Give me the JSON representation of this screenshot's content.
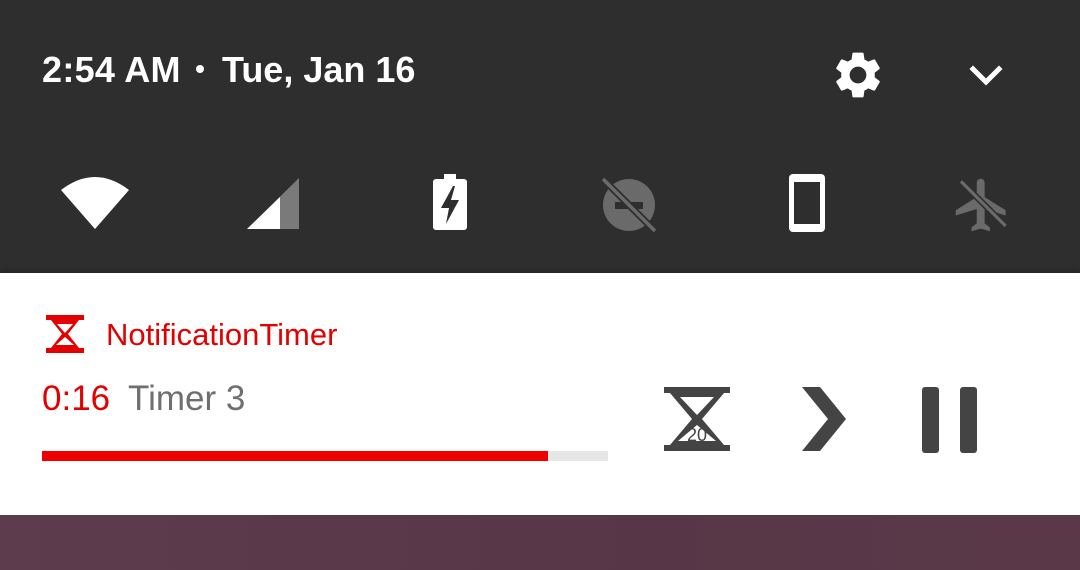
{
  "status": {
    "time": "2:54 AM",
    "date": "Tue, Jan 16"
  },
  "quick_settings": {
    "tiles": [
      {
        "icon": "wifi-icon",
        "state": "on"
      },
      {
        "icon": "cellular-signal-icon",
        "state": "partial"
      },
      {
        "icon": "battery-charging-icon",
        "state": "on"
      },
      {
        "icon": "do-not-disturb-off-icon",
        "state": "off"
      },
      {
        "icon": "rotation-portrait-icon",
        "state": "on"
      },
      {
        "icon": "airplane-mode-off-icon",
        "state": "off"
      }
    ],
    "background": "#2e2e2e"
  },
  "notification": {
    "app_name": "NotificationTimer",
    "remaining": "0:16",
    "timer_name": "Timer 3",
    "progress": 0.894,
    "accent": "#e40000",
    "actions": [
      {
        "icon": "hourglass-20-icon",
        "badge": "20"
      },
      {
        "icon": "chevron-right-icon"
      },
      {
        "icon": "pause-icon"
      }
    ]
  }
}
